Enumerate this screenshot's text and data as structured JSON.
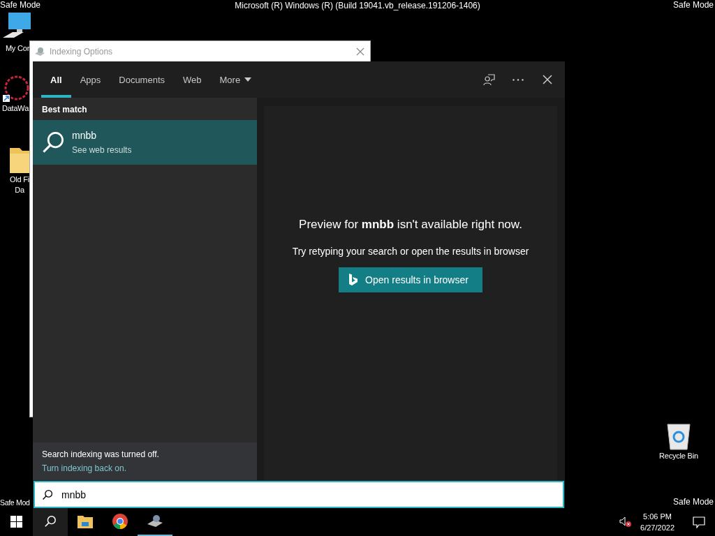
{
  "corner_labels": {
    "top_left": "Safe Mode",
    "top_right": "Safe Mode",
    "bottom_left": "Safe Mod",
    "bottom_right": "Safe Mode"
  },
  "desktop_title": "Microsoft (R) Windows (R) (Build 19041.vb_release.191206-1406)",
  "desktop_icons": [
    {
      "kind": "computer",
      "lines": [
        "My Cor"
      ]
    },
    {
      "kind": "app",
      "lines": [
        "DataWa"
      ]
    },
    {
      "kind": "folder",
      "lines": [
        "Old Fi",
        "Da"
      ]
    },
    {
      "kind": "recycle",
      "lines": [
        "Recycle Bin"
      ]
    }
  ],
  "background_window": {
    "title": "Indexing Options"
  },
  "search": {
    "tabs": [
      {
        "label": "All",
        "selected": true,
        "dropdown": false
      },
      {
        "label": "Apps",
        "selected": false,
        "dropdown": false
      },
      {
        "label": "Documents",
        "selected": false,
        "dropdown": false
      },
      {
        "label": "Web",
        "selected": false,
        "dropdown": false
      },
      {
        "label": "More",
        "selected": false,
        "dropdown": true
      }
    ],
    "section_heading": "Best match",
    "best_match": {
      "title": "mnbb",
      "subtitle": "See web results",
      "selected": true
    },
    "notice": {
      "text": "Search indexing was turned off.",
      "link": "Turn indexing back on."
    },
    "preview": {
      "message": "Preview for **mnbb** isn't available right now.",
      "hint": "Try retyping your search or open the results in browser",
      "button": "Open results in browser"
    },
    "query": "mnbb"
  },
  "taskbar": {
    "apps": [
      {
        "kind": "start",
        "active": false
      },
      {
        "kind": "search",
        "active": false
      },
      {
        "kind": "explorer",
        "active": false
      },
      {
        "kind": "browser",
        "active": false
      },
      {
        "kind": "indexing",
        "active": true
      }
    ],
    "volume_muted": true,
    "time": "5:06 PM",
    "date": "6/27/2022"
  }
}
